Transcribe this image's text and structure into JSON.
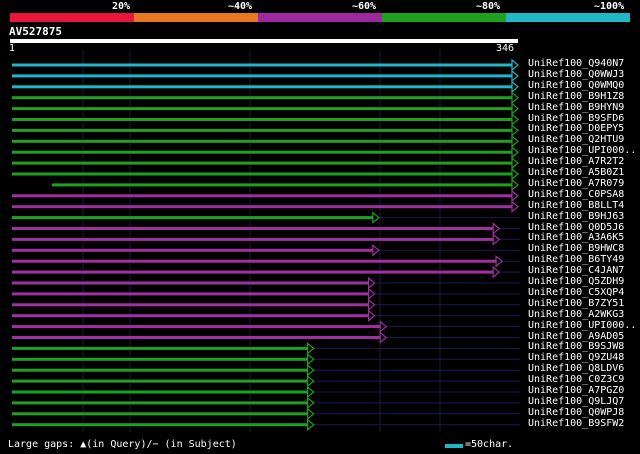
{
  "legend": {
    "colors": [
      "#e8163c",
      "#e87820",
      "#9e28a0",
      "#20a020",
      "#20b8c8"
    ],
    "labels": [
      "20%",
      "~40%",
      "~60%",
      "~80%",
      "~100%"
    ]
  },
  "query": {
    "id": "AV527875",
    "start": "1",
    "end": "346"
  },
  "hits": [
    {
      "name": "UniRef100_Q940N7",
      "color": "cyan",
      "end": 346
    },
    {
      "name": "UniRef100_Q0WWJ3",
      "color": "cyan",
      "end": 346
    },
    {
      "name": "UniRef100_Q0WMQ0",
      "color": "cyan",
      "end": 346
    },
    {
      "name": "UniRef100_B9H1Z8",
      "color": "green",
      "end": 346
    },
    {
      "name": "UniRef100_B9HYN9",
      "color": "green",
      "end": 346
    },
    {
      "name": "UniRef100_B9SFD6",
      "color": "green",
      "end": 346
    },
    {
      "name": "UniRef100_D0EPY5",
      "color": "green",
      "end": 346
    },
    {
      "name": "UniRef100_Q2HTU9",
      "color": "green",
      "end": 346
    },
    {
      "name": "UniRef100_UPI000..",
      "color": "green",
      "end": 346
    },
    {
      "name": "UniRef100_A7R2T2",
      "color": "green",
      "end": 346
    },
    {
      "name": "UniRef100_A5B0Z1",
      "color": "green",
      "end": 346
    },
    {
      "name": "UniRef100_A7R079",
      "color": "green",
      "end": 346
    },
    {
      "name": "UniRef100_C0PSA8",
      "color": "purple",
      "end": 346
    },
    {
      "name": "UniRef100_B8LLT4",
      "color": "purple",
      "end": 346
    },
    {
      "name": "UniRef100_B9HJ63",
      "color": "green",
      "end": 250
    },
    {
      "name": "UniRef100_Q0D5J6",
      "color": "purple",
      "end": 333
    },
    {
      "name": "UniRef100_A3A6K5",
      "color": "purple",
      "end": 333
    },
    {
      "name": "UniRef100_B9HWC8",
      "color": "purple",
      "end": 250
    },
    {
      "name": "UniRef100_B6TY49",
      "color": "purple",
      "end": 335
    },
    {
      "name": "UniRef100_C4JAN7",
      "color": "purple",
      "end": 333
    },
    {
      "name": "UniRef100_Q5ZDH9",
      "color": "purple",
      "end": 247
    },
    {
      "name": "UniRef100_C5XQP4",
      "color": "purple",
      "end": 247
    },
    {
      "name": "UniRef100_B7ZY51",
      "color": "purple",
      "end": 247
    },
    {
      "name": "UniRef100_A2WKG3",
      "color": "purple",
      "end": 247
    },
    {
      "name": "UniRef100_UPI000..",
      "color": "purple",
      "end": 255
    },
    {
      "name": "UniRef100_A9AD05",
      "color": "purple",
      "end": 255
    },
    {
      "name": "UniRef100_B9SJW8",
      "color": "green",
      "end": 205
    },
    {
      "name": "UniRef100_Q9ZU48",
      "color": "green",
      "end": 205
    },
    {
      "name": "UniRef100_Q8LDV6",
      "color": "green",
      "end": 205
    },
    {
      "name": "UniRef100_C0Z3C9",
      "color": "green",
      "end": 205
    },
    {
      "name": "UniRef100_A7PGZ0",
      "color": "green",
      "end": 205
    },
    {
      "name": "UniRef100_Q9LJQ7",
      "color": "green",
      "end": 205
    },
    {
      "name": "UniRef100_Q0WPJ8",
      "color": "green",
      "end": 205
    },
    {
      "name": "UniRef100_B9SFW2",
      "color": "green",
      "end": 205
    }
  ],
  "footer": {
    "gaps_text": "Large gaps: ▲(in Query)/− (in Subject)",
    "scale_text": "=50char."
  }
}
